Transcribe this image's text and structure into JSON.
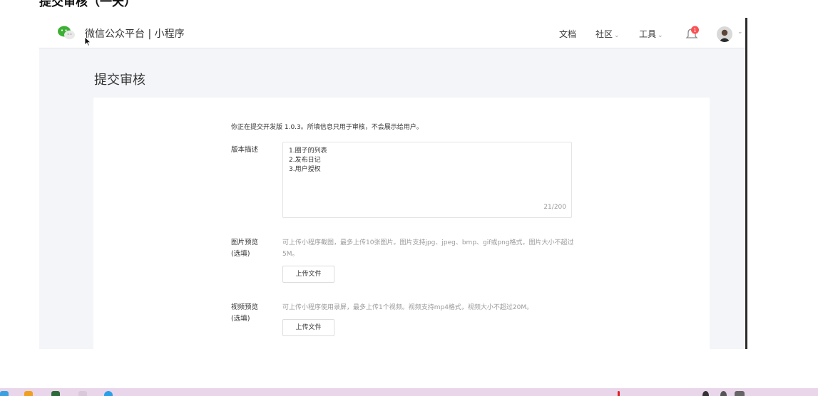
{
  "top_heading": "提交审核（一天）",
  "header": {
    "brand": "微信公众平台 | 小程序",
    "nav_docs": "文档",
    "nav_community": "社区",
    "nav_tools": "工具",
    "notification_count": "1"
  },
  "page": {
    "title": "提交审核"
  },
  "form": {
    "intro": "你正在提交开发版 1.0.3。所填信息只用于审核，不会展示给用户。",
    "version_label": "版本描述",
    "version_lines": [
      "1.圈子的列表",
      "2.发布日记",
      "3.用户授权"
    ],
    "version_counter": "21/200",
    "image_label_line1": "图片预览",
    "image_label_line2": "(选填)",
    "image_hint": "可上传小程序截图，最多上传10张图片。图片支持jpg、jpeg、bmp、gif或png格式，图片大小不超过5M。",
    "image_upload": "上传文件",
    "video_label_line1": "视频预览",
    "video_label_line2": "(选填)",
    "video_hint": "可上传小程序使用录屏，最多上传1个视频。视频支持mp4格式，视频大小不超过20M。",
    "video_upload": "上传文件"
  },
  "colors": {
    "badge": "#fa5151",
    "page_bg": "#f4f5f9",
    "taskbar": "#ead6ea"
  }
}
